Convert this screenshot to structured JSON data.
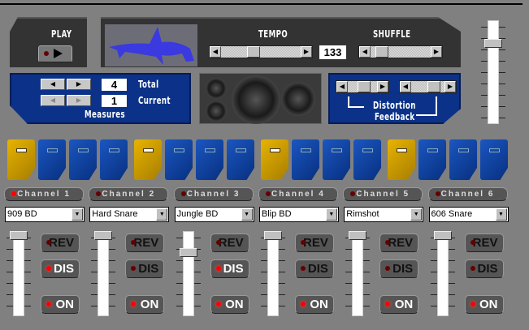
{
  "transport": {
    "play_label": "PLAY",
    "play_icon": "play-icon"
  },
  "tempo": {
    "label": "TEMPO",
    "value": "133",
    "position": 0.38
  },
  "shuffle": {
    "label": "SHUFFLE",
    "position": 0.1
  },
  "measures": {
    "label": "Measures",
    "total_label": "Total",
    "total": "4",
    "current_label": "Current",
    "current": "1"
  },
  "effects": {
    "distortion_label": "Distortion",
    "feedback_label": "Feedback",
    "distortion": 0.55,
    "feedback": 0.75
  },
  "master_volume": 0.8,
  "steps": [
    true,
    false,
    false,
    false,
    true,
    false,
    false,
    false,
    true,
    false,
    false,
    false,
    true,
    false,
    false,
    false
  ],
  "channels": [
    {
      "label": "Channel 1",
      "sound": "909 BD",
      "selected": true,
      "volume": 1.0,
      "rev": false,
      "dis": true,
      "on": true
    },
    {
      "label": "Channel 2",
      "sound": "Hard Snare",
      "selected": false,
      "volume": 1.0,
      "rev": false,
      "dis": false,
      "on": true
    },
    {
      "label": "Channel 3",
      "sound": "Jungle BD",
      "selected": false,
      "volume": 0.78,
      "rev": false,
      "dis": true,
      "on": true
    },
    {
      "label": "Channel 4",
      "sound": "Blip BD",
      "selected": false,
      "volume": 1.0,
      "rev": false,
      "dis": false,
      "on": true
    },
    {
      "label": "Channel 5",
      "sound": "Rimshot",
      "selected": false,
      "volume": 1.0,
      "rev": false,
      "dis": false,
      "on": true
    },
    {
      "label": "Channel 6",
      "sound": "606 Snare",
      "selected": false,
      "volume": 1.0,
      "rev": false,
      "dis": false,
      "on": true
    }
  ],
  "fx_labels": {
    "rev": "REV",
    "dis": "DIS",
    "on": "ON"
  },
  "colors": {
    "step_accent": "#e7b300",
    "step": "#0b3288",
    "panel": "#0b3288"
  }
}
